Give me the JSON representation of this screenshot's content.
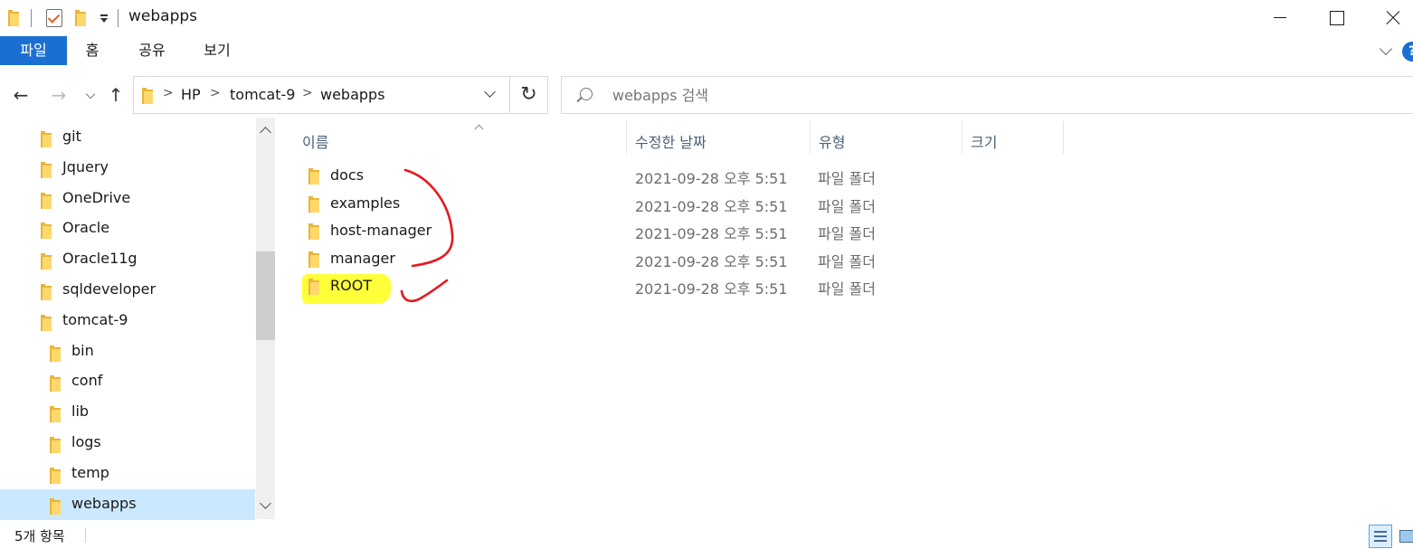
{
  "window": {
    "title": "webapps",
    "icons": [
      "folder-icon",
      "properties-check-icon",
      "new-folder-icon",
      "customize-toolbar-icon"
    ],
    "controls": [
      "minimize-icon",
      "maximize-icon",
      "close-icon"
    ]
  },
  "ribbon": {
    "tabs": [
      {
        "label": "파일",
        "active": true
      },
      {
        "label": "홈"
      },
      {
        "label": "공유"
      },
      {
        "label": "보기"
      }
    ],
    "accent_color": "#1a6fd1"
  },
  "address": {
    "breadcrumbs": [
      "HP",
      "tomcat-9",
      "webapps"
    ]
  },
  "search": {
    "placeholder": "webapps 검색"
  },
  "navigation_pane": {
    "items": [
      {
        "label": "git",
        "level": 0
      },
      {
        "label": "Jquery",
        "level": 0
      },
      {
        "label": "OneDrive",
        "level": 0
      },
      {
        "label": "Oracle",
        "level": 0
      },
      {
        "label": "Oracle11g",
        "level": 0
      },
      {
        "label": "sqldeveloper",
        "level": 0
      },
      {
        "label": "tomcat-9",
        "level": 0
      },
      {
        "label": "bin",
        "level": 1
      },
      {
        "label": "conf",
        "level": 1
      },
      {
        "label": "lib",
        "level": 1
      },
      {
        "label": "logs",
        "level": 1
      },
      {
        "label": "temp",
        "level": 1
      },
      {
        "label": "webapps",
        "level": 1,
        "selected": true
      }
    ]
  },
  "file_list": {
    "columns": [
      "이름",
      "수정한 날짜",
      "유형",
      "크기"
    ],
    "rows": [
      {
        "name": "docs",
        "modified": "2021-09-28 오후 5:51",
        "type": "파일 폴더"
      },
      {
        "name": "examples",
        "modified": "2021-09-28 오후 5:51",
        "type": "파일 폴더"
      },
      {
        "name": "host-manager",
        "modified": "2021-09-28 오후 5:51",
        "type": "파일 폴더"
      },
      {
        "name": "manager",
        "modified": "2021-09-28 오후 5:51",
        "type": "파일 폴더"
      },
      {
        "name": "ROOT",
        "modified": "2021-09-28 오후 5:51",
        "type": "파일 폴더",
        "highlighted": true
      }
    ],
    "highlight_color": "#ffff3a",
    "annotation_color": "#e8181e"
  },
  "status_bar": {
    "item_count": "5개 항목"
  }
}
